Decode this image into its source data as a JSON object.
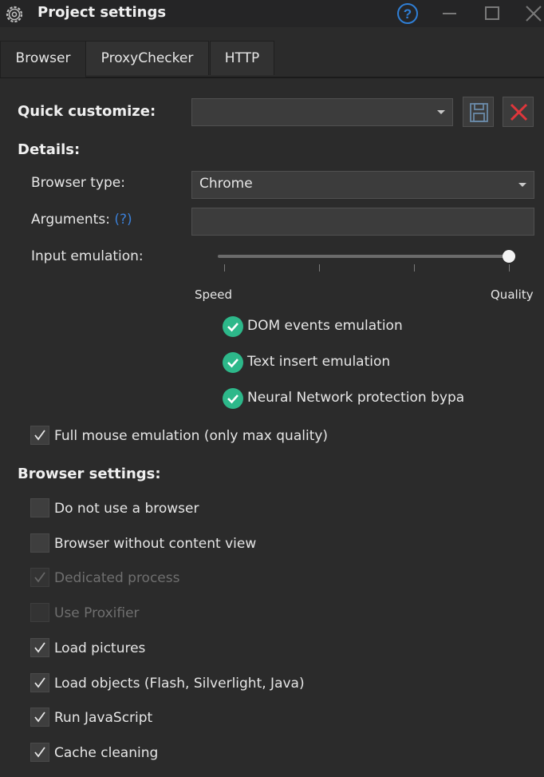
{
  "window": {
    "title": "Project settings",
    "icon": "gear-icon"
  },
  "tabs": [
    {
      "label": "Browser",
      "active": true
    },
    {
      "label": "ProxyChecker",
      "active": false
    },
    {
      "label": "HTTP",
      "active": false
    }
  ],
  "quick_customize": {
    "label": "Quick customize:",
    "value": ""
  },
  "details": {
    "heading": "Details:",
    "browser_type_label": "Browser type:",
    "browser_type_value": "Chrome",
    "arguments_label": "Arguments:",
    "arguments_help": "(?)",
    "arguments_value": "",
    "input_emulation_label": "Input emulation:",
    "slider_min_label": "Speed",
    "slider_max_label": "Quality",
    "slider_level": 1.0,
    "emulation_features": [
      "DOM events emulation",
      "Text insert emulation",
      "Neural Network protection bypa:"
    ],
    "full_mouse_label": "Full mouse emulation (only max quality)",
    "full_mouse_checked": true
  },
  "browser_settings": {
    "heading": "Browser settings:",
    "options": [
      {
        "label": "Do not use a browser",
        "checked": false,
        "disabled": false
      },
      {
        "label": "Browser without content view",
        "checked": false,
        "disabled": false
      },
      {
        "label": "Dedicated process",
        "checked": true,
        "disabled": true
      },
      {
        "label": "Use Proxifier",
        "checked": false,
        "disabled": true
      },
      {
        "label": "Load pictures",
        "checked": true,
        "disabled": false
      },
      {
        "label": "Load objects (Flash, Silverlight, Java)",
        "checked": true,
        "disabled": false
      },
      {
        "label": "Run JavaScript",
        "checked": true,
        "disabled": false
      },
      {
        "label": "Cache cleaning",
        "checked": true,
        "disabled": false
      }
    ]
  },
  "colors": {
    "background": "#2b2b2b",
    "accent_blue": "#2f7fd6",
    "delete_red": "#e0363b",
    "feature_green": "#2db88a"
  }
}
